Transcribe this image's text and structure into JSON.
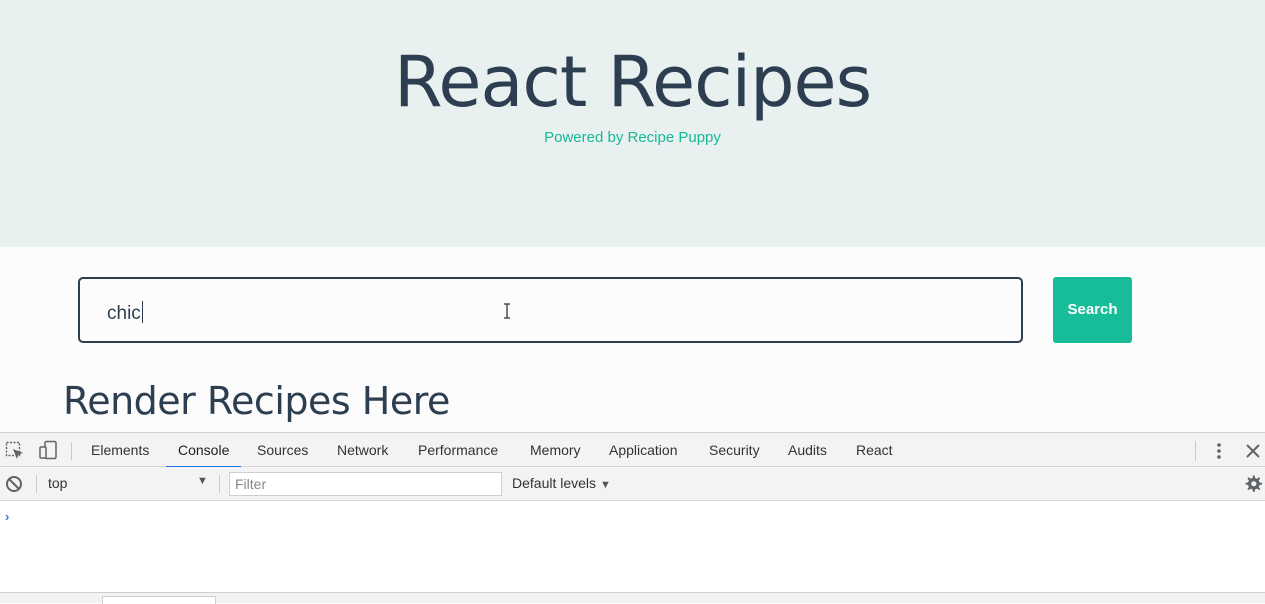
{
  "hero": {
    "title": "React Recipes",
    "subtitle": "Powered by Recipe Puppy"
  },
  "search": {
    "value": "chic",
    "button_label": "Search"
  },
  "main": {
    "heading": "Render Recipes Here"
  },
  "devtools": {
    "tabs": [
      "Elements",
      "Console",
      "Sources",
      "Network",
      "Performance",
      "Memory",
      "Application",
      "Security",
      "Audits",
      "React"
    ],
    "active_tab": "Console",
    "context": "top",
    "filter_placeholder": "Filter",
    "levels_label": "Default levels",
    "prompt_symbol": "›"
  },
  "colors": {
    "accent": "#17bc99",
    "text": "#2c3e50",
    "hero_bg": "#e9f0f0",
    "devtools_active": "#1a73e8"
  },
  "icons": [
    "inspect-element-icon",
    "device-toolbar-icon",
    "more-options-icon",
    "close-icon",
    "clear-console-icon",
    "dropdown-arrow-icon",
    "settings-gear-icon",
    "text-cursor-icon"
  ]
}
